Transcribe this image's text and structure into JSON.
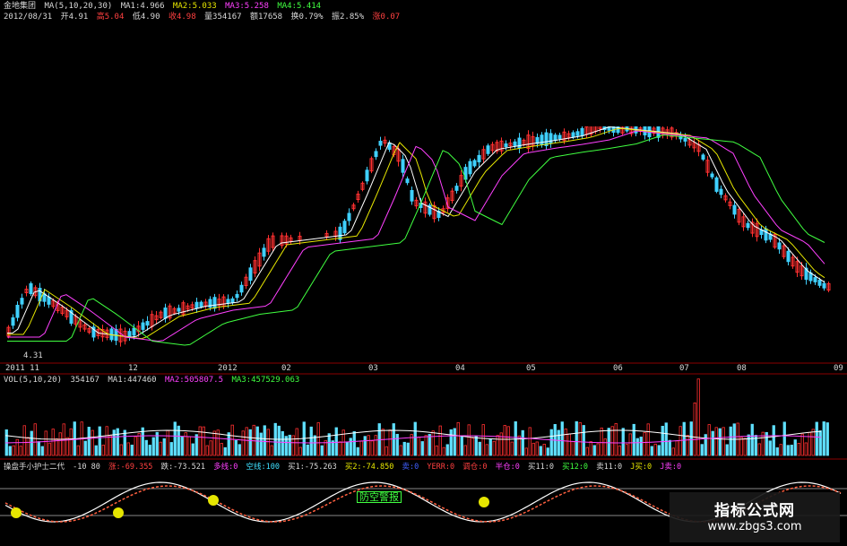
{
  "header": {
    "stock_name": "金地集团",
    "ma_params": "MA(5,10,20,30)",
    "ma1": "MA1:4.966",
    "ma2": "MA2:5.033",
    "ma3": "MA3:5.258",
    "ma4": "MA4:5.414"
  },
  "quote": {
    "date": "2012/08/31",
    "open": "开4.91",
    "high": "高5.04",
    "low": "低4.90",
    "close": "收4.98",
    "volume": "量354167",
    "amount": "额17658",
    "turnover": "换0.79%",
    "amplitude": "振2.85%",
    "change": "涨0.07"
  },
  "price_chart": {
    "low_marker": "4.31",
    "x_labels": [
      "2011 11",
      "12",
      "2012",
      "02",
      "03",
      "04",
      "05",
      "06",
      "07",
      "08",
      "09"
    ]
  },
  "volume_panel": {
    "params": "VOL(5,10,20)",
    "vol": "354167",
    "ma1": "MA1:447460",
    "ma2": "MA2:505807.5",
    "ma3": "MA3:457529.063"
  },
  "indicator_panel": {
    "name": "操盘手小护士二代",
    "range": "-10 80",
    "zhang": "涨:-69.355",
    "die": "跌:-73.521",
    "duo": "多线:0",
    "kong": "空线:100",
    "mai1": "买1:-75.263",
    "mai2": "买2:-74.850",
    "x1": "卖:0",
    "x2": "YERR:0",
    "tiaocang": "调仓:0",
    "banci": "半仓:0",
    "mai11": "买11:0",
    "mai12": "买12:0",
    "mai11b": "卖11:0",
    "jmai": "J买:0",
    "jmai2": "J卖:0",
    "warning": "防空警报"
  },
  "watermark": {
    "title": "指标公式网",
    "url": "www.zbgs3.com"
  }
}
